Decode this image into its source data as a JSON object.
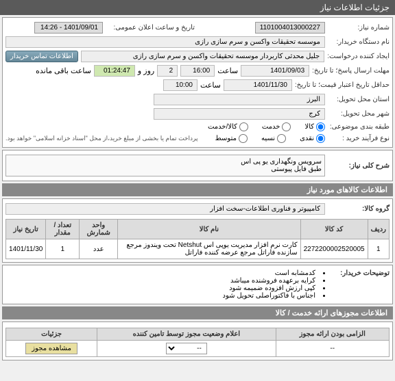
{
  "header": {
    "title": "جزئیات اطلاعات نیاز"
  },
  "need": {
    "number_label": "شماره نیاز:",
    "number": "1101004013000227",
    "date_label": "تاریخ و ساعت اعلان عمومی:",
    "date": "1401/09/01 - 14:26",
    "buyer_label": "نام دستگاه خریدار:",
    "buyer": "موسسه تحقیقات واکسن و سرم سازی رازی",
    "requester_label": "ایجاد کننده درخواست:",
    "requester": "جلیل محدثی کاربردار موسسه تحقیقات واکسن و سرم سازی رازی",
    "contact_btn": "اطلاعات تماس خریدار",
    "deadline_label": "مهلت ارسال پاسخ؛ تا تاریخ:",
    "deadline_date": "1401/09/03",
    "time_label": "ساعت",
    "deadline_time": "16:00",
    "days_label": "روز و",
    "days": "2",
    "remain_time": "01:24:47",
    "remain_label": "ساعت باقی مانده",
    "min_credit_label": "حداقل تاریخ اعتبار قیمت؛ تا تاریخ:",
    "min_credit_date": "1401/11/30",
    "min_credit_time": "10:00",
    "province_label": "استان محل تحویل:",
    "province": "البرز",
    "city_label": "شهر محل تحویل:",
    "city": "کرج",
    "subject_label": "طبقه بندی موضوعی:",
    "subject_goods": "کالا",
    "subject_service": "خدمت",
    "subject_both": "کالا/خدمت",
    "pay_type_label": "نوع فرآیند خرید :",
    "pay_cash": "نقدی",
    "pay_credit": "نسیه",
    "pay_part": "متوسط",
    "pay_note": "پرداخت تمام یا بخشی از مبلغ خرید،از محل \"اسناد خزانه اسلامی\" خواهد بود."
  },
  "desc": {
    "title": "شرح کلی نیاز:",
    "line1": "سرویس ونگهداری یو پی اس",
    "line2": "طبق فایل پیوستی"
  },
  "goods": {
    "title": "اطلاعات کالاهای مورد نیاز",
    "group_label": "گروه کالا:",
    "group": "کامپیوتر و فناوری اطلاعات-سخت افزار",
    "headers": {
      "row": "ردیف",
      "code": "کد کالا",
      "name": "نام کالا",
      "unit": "واحد شمارش",
      "qty": "تعداد / مقدار",
      "date": "تاریخ نیاز"
    },
    "rows": [
      {
        "idx": "1",
        "code": "2272200002520005",
        "name": "کارت نرم افزار مدیریت یوپی اس Netshut تحت ویندوز مرجع سازنده فاراتل مرجع عرضه کننده فاراتل",
        "unit": "عدد",
        "qty": "1",
        "date": "1401/11/30"
      }
    ]
  },
  "buyer_notes": {
    "label": "توضیحات خریدار:",
    "items": [
      "کدمشابه است",
      "کرایه برعهده فروشنده میباشد",
      "کپی ارزش افزوده ضمیمه شود",
      "اجناس با فاکتوراصلی تحویل شود"
    ]
  },
  "permits": {
    "title": "اطلاعات مجوزهای ارائه خدمت / کالا",
    "mandatory_header": "الزامی بودن ارائه مجوز",
    "status_header": "اعلام وضعیت مجوز توسط تامین کننده",
    "details_header": "جزئیات",
    "view_btn": "مشاهده مجوز",
    "dash": "--"
  }
}
